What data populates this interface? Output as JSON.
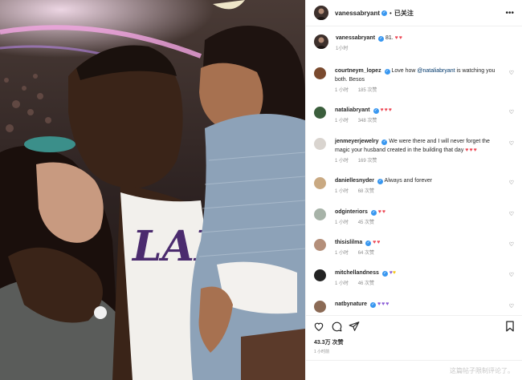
{
  "post": {
    "author": "vanessabryant",
    "follow_label": "已关注",
    "caption_user": "vanessabryant",
    "caption_text": "81.",
    "caption_emoji": "♥♥",
    "caption_time": "1小时",
    "likes": "43.3万 次赞",
    "time_ago": "1 小时前",
    "comments_disabled": "这篇帖子限制评论了。"
  },
  "comments": [
    {
      "user": "courtneym_lopez",
      "verified": true,
      "text_parts": [
        "Love how ",
        "@nataliabryant",
        " is watching you both. Besos"
      ],
      "time": "1 小时",
      "likes": "185 次赞",
      "avatar_color": "#7a4a2e"
    },
    {
      "user": "nataliabryant",
      "verified": true,
      "text": "",
      "emoji": "♥♥♥",
      "time": "1 小时",
      "likes": "348 次赞",
      "avatar_color": "#3b5e3c"
    },
    {
      "user": "jenmeyerjewelry",
      "verified": true,
      "text": "We were there and I will never forget the magic your husband created in the building that day",
      "emoji": "♥♥♥",
      "time": "1 小时",
      "likes": "169 次赞",
      "avatar_color": "#d9d4cf"
    },
    {
      "user": "daniellesnyder",
      "verified": true,
      "text": "Always and forever",
      "time": "1 小时",
      "likes": "68 次赞",
      "avatar_color": "#c9a982"
    },
    {
      "user": "odginteriors",
      "verified": true,
      "text": "",
      "emoji": "♥♥",
      "time": "1 小时",
      "likes": "45 次赞",
      "avatar_color": "#a7b3a8"
    },
    {
      "user": "thisislilma",
      "verified": true,
      "text": "",
      "emoji": "♥♥",
      "time": "1 小时",
      "likes": "64 次赞",
      "avatar_color": "#b48f7a"
    },
    {
      "user": "mitchellandness",
      "verified": true,
      "text": "",
      "emoji": "♥♥",
      "time": "1 小时",
      "likes": "46 次赞",
      "avatar_color": "#222222"
    },
    {
      "user": "natbynature",
      "verified": true,
      "text": "",
      "emoji": "♥♥♥",
      "time": "",
      "likes": "",
      "avatar_color": "#8b6a55"
    }
  ],
  "colors": {
    "like_red": "#ed4956",
    "purple_heart": "#8a5bd6",
    "yellow_heart": "#f5c518",
    "verified_blue": "#3897f0"
  }
}
